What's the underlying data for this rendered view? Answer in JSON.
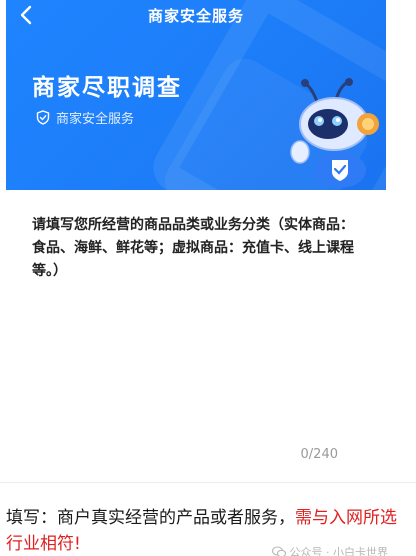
{
  "header": {
    "title": "商家安全服务"
  },
  "hero": {
    "title": "商家尽职调查",
    "subtitle": "商家安全服务"
  },
  "form": {
    "prompt": "请填写您所经营的商品品类或业务分类（实体商品：食品、海鲜、鲜花等；虚拟商品：充值卡、线上课程等。）",
    "char_count": "0/240"
  },
  "caption": {
    "normal": "填写：商户真实经营的产品或者服务，",
    "highlight": "需与入网所选行业相符!"
  },
  "watermark": {
    "text": "公众号 · 小白卡世界"
  },
  "colors": {
    "banner_blue": "#1f84ff",
    "highlight_red": "#e02020"
  },
  "icons": {
    "back": "chevron-left-icon",
    "shield": "shield-check-icon",
    "wechat": "wechat-icon"
  }
}
